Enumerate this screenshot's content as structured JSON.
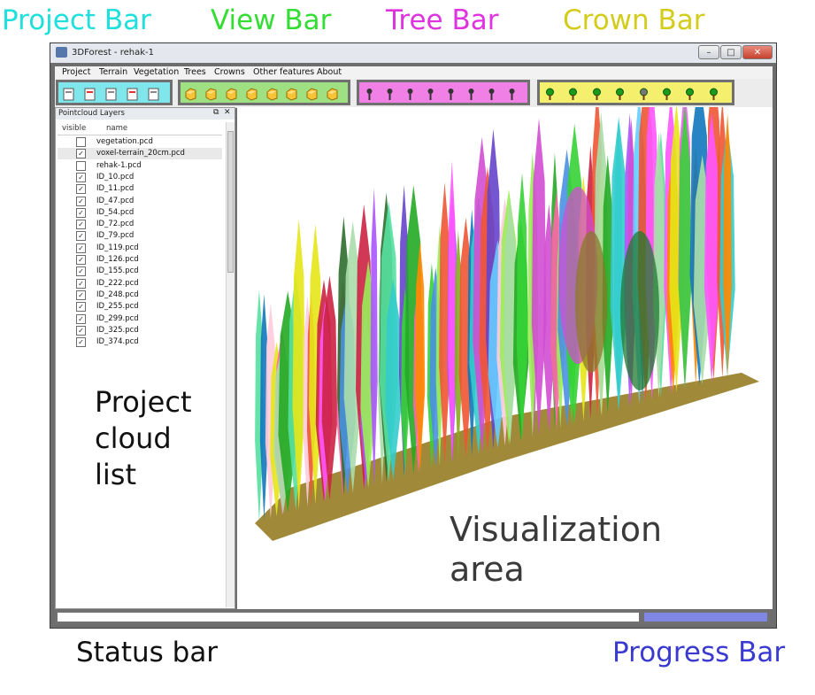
{
  "annotations": {
    "project_bar": {
      "text": "Project Bar",
      "color": "#1fe0dc"
    },
    "view_bar": {
      "text": "View Bar",
      "color": "#33dd33"
    },
    "tree_bar": {
      "text": "Tree Bar",
      "color": "#e033e0"
    },
    "crown_bar": {
      "text": "Crown Bar",
      "color": "#d4cc1a"
    },
    "project_cloud_list": [
      "Project",
      "cloud",
      "list"
    ],
    "visualization_area": [
      "Visualization",
      "area"
    ],
    "status_bar": "Status bar",
    "progress_bar": {
      "text": "Progress Bar",
      "color": "#3a3ad0"
    }
  },
  "window": {
    "title": "3DForest - rehak-1",
    "controls": {
      "minimize": "–",
      "maximize": "□",
      "close": "✕"
    }
  },
  "menu": [
    "Project",
    "Terrain",
    "Vegetation",
    "Trees",
    "Crowns",
    "Other features",
    "About"
  ],
  "toolbars": {
    "project": {
      "color": "#7fe6ec",
      "icons": [
        "new-project-icon",
        "open-project-icon",
        "import-cloud-icon",
        "export-cloud-icon",
        "close-project-icon"
      ]
    },
    "view": {
      "color": "#9fe082",
      "icons": [
        "front-view-icon",
        "back-view-icon",
        "top-view-icon",
        "bottom-view-icon",
        "left-view-icon",
        "right-view-icon",
        "iso-view-icon",
        "iso-view-back-icon"
      ]
    },
    "tree": {
      "color": "#f07fe6",
      "icons": [
        "tree-attributes-icon",
        "dbh-icon",
        "height-icon",
        "position-icon",
        "length-icon",
        "stem-curve-icon",
        "convex-icon",
        "concave-icon"
      ]
    },
    "crown": {
      "color": "#f4f06e",
      "icons": [
        "crown-icon",
        "crown-position-icon",
        "crown-height-icon",
        "crown-volume-icon",
        "crown-surface-icon",
        "crown-section-icon",
        "crown-intersect-icon",
        "crown-export-icon"
      ]
    }
  },
  "panel": {
    "title": "Pointcloud Layers",
    "float_icon": "⧉",
    "close_icon": "✕",
    "columns": [
      "visible",
      "name"
    ],
    "rows": [
      {
        "name": "vegetation.pcd",
        "visible": false
      },
      {
        "name": "voxel-terrain_20cm.pcd",
        "visible": true
      },
      {
        "name": "rehak-1.pcd",
        "visible": false
      },
      {
        "name": "ID_10.pcd",
        "visible": true
      },
      {
        "name": "ID_11.pcd",
        "visible": true
      },
      {
        "name": "ID_47.pcd",
        "visible": true
      },
      {
        "name": "ID_54.pcd",
        "visible": true
      },
      {
        "name": "ID_72.pcd",
        "visible": true
      },
      {
        "name": "ID_79.pcd",
        "visible": true
      },
      {
        "name": "ID_119.pcd",
        "visible": true
      },
      {
        "name": "ID_126.pcd",
        "visible": true
      },
      {
        "name": "ID_155.pcd",
        "visible": true
      },
      {
        "name": "ID_222.pcd",
        "visible": true
      },
      {
        "name": "ID_248.pcd",
        "visible": true
      },
      {
        "name": "ID_255.pcd",
        "visible": true
      },
      {
        "name": "ID_299.pcd",
        "visible": true
      },
      {
        "name": "ID_325.pcd",
        "visible": true
      },
      {
        "name": "ID_374.pcd",
        "visible": true
      }
    ]
  },
  "visualization": {
    "terrain_color": "#a08a3a",
    "palette": [
      "#35d335",
      "#ff55ff",
      "#4a90e2",
      "#22aa22",
      "#e6e617",
      "#55e0a0",
      "#ff8800",
      "#aa55ff",
      "#d24dd2",
      "#2d6e2d",
      "#ff66aa",
      "#66ccff",
      "#88aa22",
      "#cc2244",
      "#33cccc",
      "#99ee55",
      "#ffccdd",
      "#6644cc",
      "#1177bb",
      "#ee5533",
      "#aaddaa"
    ]
  }
}
